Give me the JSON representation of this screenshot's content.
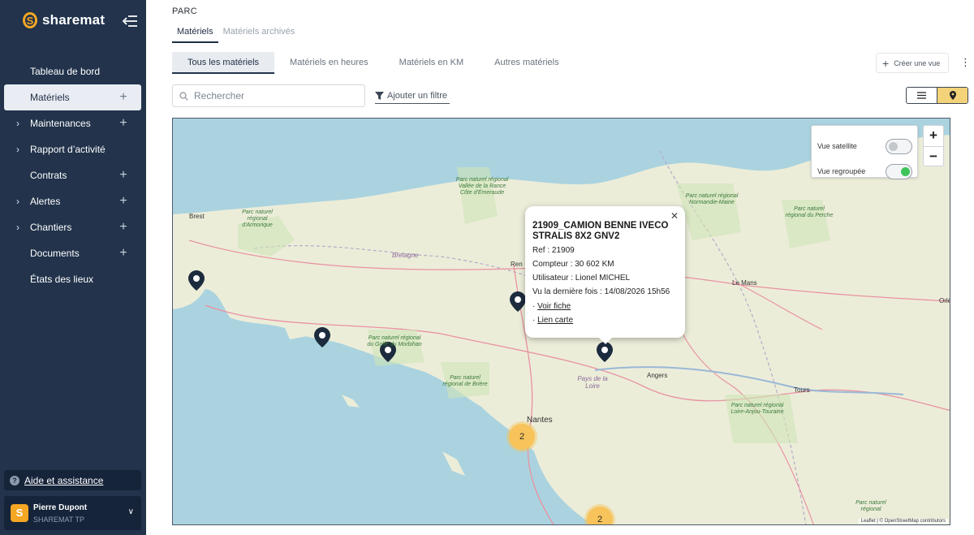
{
  "brand": {
    "name": "sharemat",
    "logo_letter": "S"
  },
  "sidebar": {
    "items": [
      {
        "label": "Tableau de bord",
        "chevron": false,
        "plus": false,
        "active": false
      },
      {
        "label": "Matériels",
        "chevron": false,
        "plus": true,
        "active": true
      },
      {
        "label": "Maintenances",
        "chevron": true,
        "plus": true,
        "active": false
      },
      {
        "label": "Rapport d’activité",
        "chevron": true,
        "plus": false,
        "active": false
      },
      {
        "label": "Contrats",
        "chevron": false,
        "plus": true,
        "active": false
      },
      {
        "label": "Alertes",
        "chevron": true,
        "plus": true,
        "active": false
      },
      {
        "label": "Chantiers",
        "chevron": true,
        "plus": true,
        "active": false
      },
      {
        "label": "Documents",
        "chevron": false,
        "plus": true,
        "active": false
      },
      {
        "label": "États des lieux",
        "chevron": false,
        "plus": false,
        "active": false
      }
    ],
    "help": "Aide et assistance",
    "user": {
      "name": "Pierre Dupont",
      "company": "SHAREMAT TP",
      "avatar_letter": "S"
    }
  },
  "page": {
    "section": "PARC",
    "subtabs": [
      "Matériels",
      "Matériels archivés"
    ],
    "view_tabs": [
      "Tous les matériels",
      "Matériels en heures",
      "Matériels en KM",
      "Autres matériels"
    ],
    "create_view": "Créer une vue",
    "search_placeholder": "Rechercher",
    "add_filter": "Ajouter un filtre"
  },
  "map": {
    "satellite_label": "Vue satellite",
    "satellite_on": false,
    "grouped_label": "Vue regroupée",
    "grouped_on": true,
    "zoom_in": "+",
    "zoom_out": "−",
    "popup": {
      "title": "21909_CAMION BENNE IVECO STRALIS 8X2 GNV2",
      "ref": "Ref : 21909",
      "counter": "Compteur : 30 602 KM",
      "user": "Utilisateur : Lionel MICHEL",
      "last_seen": "Vu la dernière fois : 14/08/2026 15h56",
      "link_sheet": "Voir fiche",
      "link_map": "Lien carte"
    },
    "clusters": [
      "2",
      "2"
    ],
    "places": [
      "Brest",
      "Bretagne",
      "Ren",
      "Le Mans",
      "Orléa",
      "Angers",
      "Pays de la Loire",
      "Nantes",
      "Tours"
    ],
    "parks": [
      "Parc naturel régional d'Armorique",
      "Parc naturel régional Vallée de la Rance Côte d'Émeraude",
      "Parc naturel régional du Golfe du Morbihan",
      "Parc naturel régional de Brière",
      "Parc naturel régional Normandie-Maine",
      "Parc naturel régional du Perche",
      "Parc naturel régional Loire-Anjou-Touraine",
      "Parc naturel régional"
    ],
    "attribution": "Leaflet | © OpenStreetMap contributors"
  },
  "colors": {
    "sidebar": "#22334b",
    "accent": "#f5a623",
    "cluster": "#f7c35a",
    "toggle_on": "#3ec45a"
  }
}
